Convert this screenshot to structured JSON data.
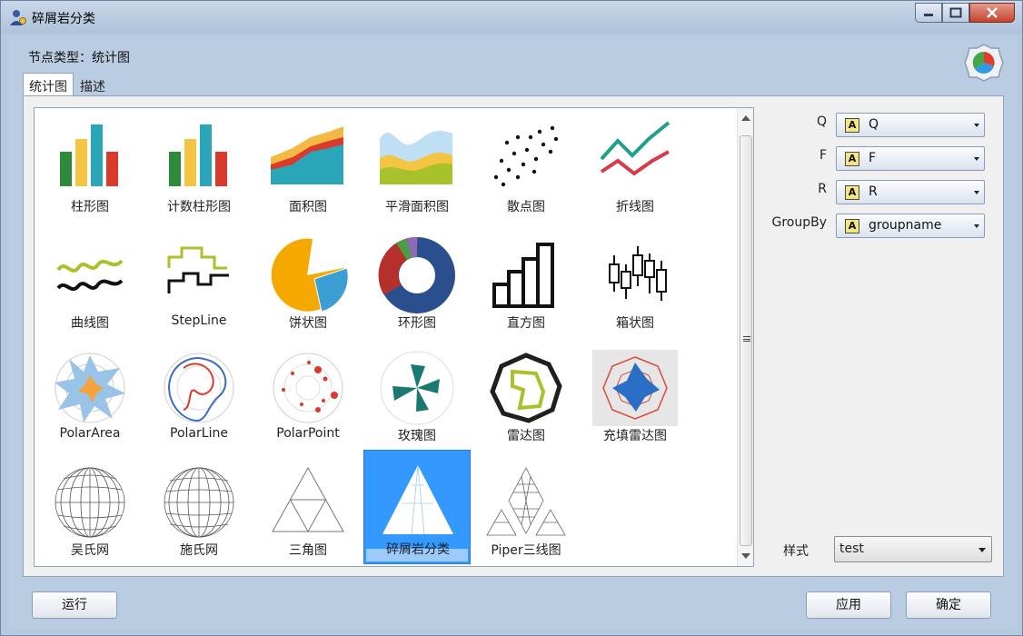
{
  "window": {
    "title": "碎屑岩分类"
  },
  "header": {
    "node_type": "节点类型：统计图"
  },
  "tabs": [
    {
      "label": "统计图"
    },
    {
      "label": "描述"
    }
  ],
  "gallery": {
    "items": [
      {
        "label": "柱形图",
        "icon": "bar-chart-icon"
      },
      {
        "label": "计数柱形图",
        "icon": "count-bar-chart-icon"
      },
      {
        "label": "面积图",
        "icon": "area-chart-icon"
      },
      {
        "label": "平滑面积图",
        "icon": "smooth-area-chart-icon"
      },
      {
        "label": "散点图",
        "icon": "scatter-chart-icon"
      },
      {
        "label": "折线图",
        "icon": "line-chart-icon"
      },
      {
        "label": "曲线图",
        "icon": "curve-chart-icon"
      },
      {
        "label": "StepLine",
        "icon": "step-line-chart-icon"
      },
      {
        "label": "饼状图",
        "icon": "pie-chart-icon"
      },
      {
        "label": "环形图",
        "icon": "donut-chart-icon"
      },
      {
        "label": "直方图",
        "icon": "histogram-icon"
      },
      {
        "label": "箱状图",
        "icon": "box-plot-icon"
      },
      {
        "label": "PolarArea",
        "icon": "polar-area-icon"
      },
      {
        "label": "PolarLine",
        "icon": "polar-line-icon"
      },
      {
        "label": "PolarPoint",
        "icon": "polar-point-icon"
      },
      {
        "label": "玫瑰图",
        "icon": "rose-chart-icon"
      },
      {
        "label": "雷达图",
        "icon": "radar-chart-icon"
      },
      {
        "label": "充填雷达图",
        "icon": "filled-radar-chart-icon"
      },
      {
        "label": "吴氏网",
        "icon": "wulff-net-icon"
      },
      {
        "label": "施氏网",
        "icon": "schmidt-net-icon"
      },
      {
        "label": "三角图",
        "icon": "ternary-chart-icon"
      },
      {
        "label": "碎屑岩分类",
        "icon": "clastic-rock-classification-icon",
        "selected": true
      },
      {
        "label": "Piper三线图",
        "icon": "piper-diagram-icon"
      }
    ]
  },
  "properties": {
    "fields": [
      {
        "label": "Q",
        "value": "Q"
      },
      {
        "label": "F",
        "value": "F"
      },
      {
        "label": "R",
        "value": "R"
      },
      {
        "label": "GroupBy",
        "value": "groupname"
      }
    ],
    "field_type_glyph": "A",
    "style_label": "样式",
    "style_value": "test"
  },
  "footer": {
    "run_label": "运行",
    "apply_label": "应用",
    "ok_label": "确定"
  },
  "colors": {
    "selection": "#3399ff",
    "window_frame": "#b9cce2"
  }
}
